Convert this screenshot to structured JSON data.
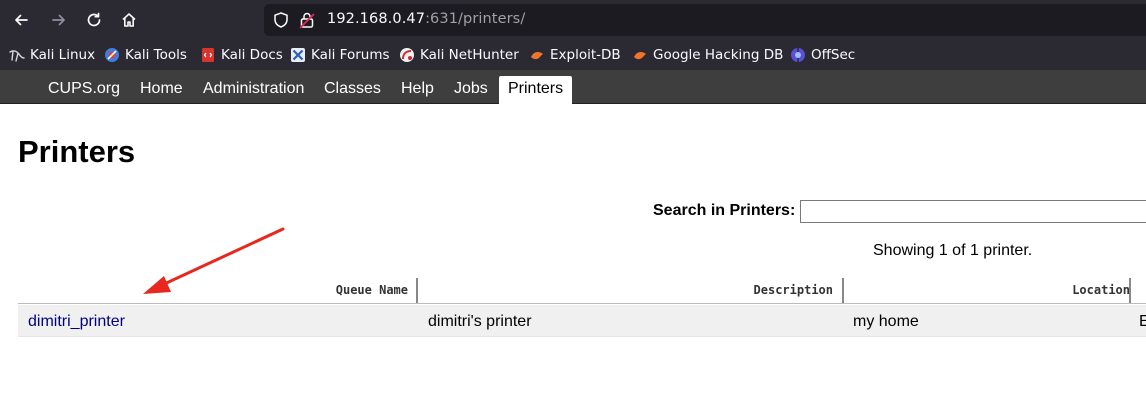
{
  "browser": {
    "url_host": "192.168.0.47",
    "url_rest": ":631/printers/",
    "bookmarks": [
      {
        "label": "Kali Linux",
        "icon": "kali-dragon-icon"
      },
      {
        "label": "Kali Tools",
        "icon": "kali-tools-icon"
      },
      {
        "label": "Kali Docs",
        "icon": "kali-docs-icon"
      },
      {
        "label": "Kali Forums",
        "icon": "kali-forums-icon"
      },
      {
        "label": "Kali NetHunter",
        "icon": "nethunter-icon"
      },
      {
        "label": "Exploit-DB",
        "icon": "exploit-db-icon"
      },
      {
        "label": "Google Hacking DB",
        "icon": "ghdb-icon"
      },
      {
        "label": "OffSec",
        "icon": "offsec-icon"
      }
    ]
  },
  "cups": {
    "nav": [
      "CUPS.org",
      "Home",
      "Administration",
      "Classes",
      "Help",
      "Jobs",
      "Printers"
    ],
    "active_nav": "Printers",
    "title": "Printers",
    "search_label": "Search in Printers:",
    "search_value": "",
    "showing": "Showing 1 of 1 printer.",
    "columns": [
      "Queue Name",
      "Description",
      "Location"
    ],
    "rows": [
      {
        "queue_name": "dimitri_printer",
        "description": "dimitri's printer",
        "location": "my home",
        "extra": "E"
      }
    ]
  },
  "annotation": {
    "arrow_color": "#e8281e"
  }
}
